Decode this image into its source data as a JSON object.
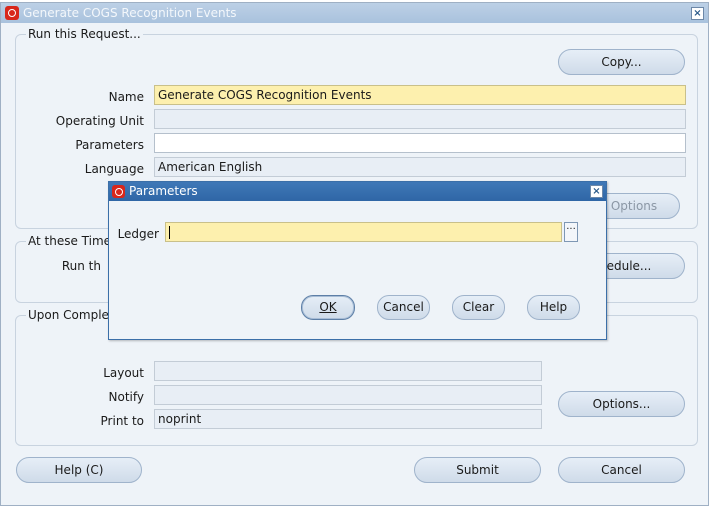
{
  "window": {
    "title": "Generate COGS Recognition Events",
    "close_glyph": "×"
  },
  "run_request": {
    "group_label": "Run this Request...",
    "copy_button": "Copy...",
    "name_label": "Name",
    "name_value": "Generate COGS Recognition Events",
    "operating_unit_label": "Operating Unit",
    "operating_unit_value": "",
    "parameters_label": "Parameters",
    "parameters_value": "",
    "language_label": "Language",
    "language_value": "American English",
    "options_button": "Options"
  },
  "at_these_times": {
    "group_label": "At these Time",
    "run_label": "Run th",
    "schedule_button": "hedule..."
  },
  "upon_completion": {
    "group_label": "Upon Complet",
    "layout_label": "Layout",
    "layout_value": "",
    "notify_label": "Notify",
    "notify_value": "",
    "print_to_label": "Print to",
    "print_to_value": "noprint",
    "options_button": "Options..."
  },
  "footer": {
    "help_button": "Help (C)",
    "submit_button": "Submit",
    "cancel_button": "Cancel"
  },
  "dialog": {
    "title": "Parameters",
    "close_glyph": "×",
    "ledger_label": "Ledger",
    "ledger_value": "",
    "lov_glyph": "···",
    "ok_button": "OK",
    "cancel_button": "Cancel",
    "clear_button": "Clear",
    "help_button": "Help"
  },
  "colors": {
    "required_field": "#fdf0ae",
    "dialog_title": "#2f66a6",
    "window_title": "#a9c2dd",
    "oracle_icon": "#d8271b"
  },
  "icons": [
    "oracle-logo-icon",
    "close-icon",
    "list-of-values-icon"
  ]
}
